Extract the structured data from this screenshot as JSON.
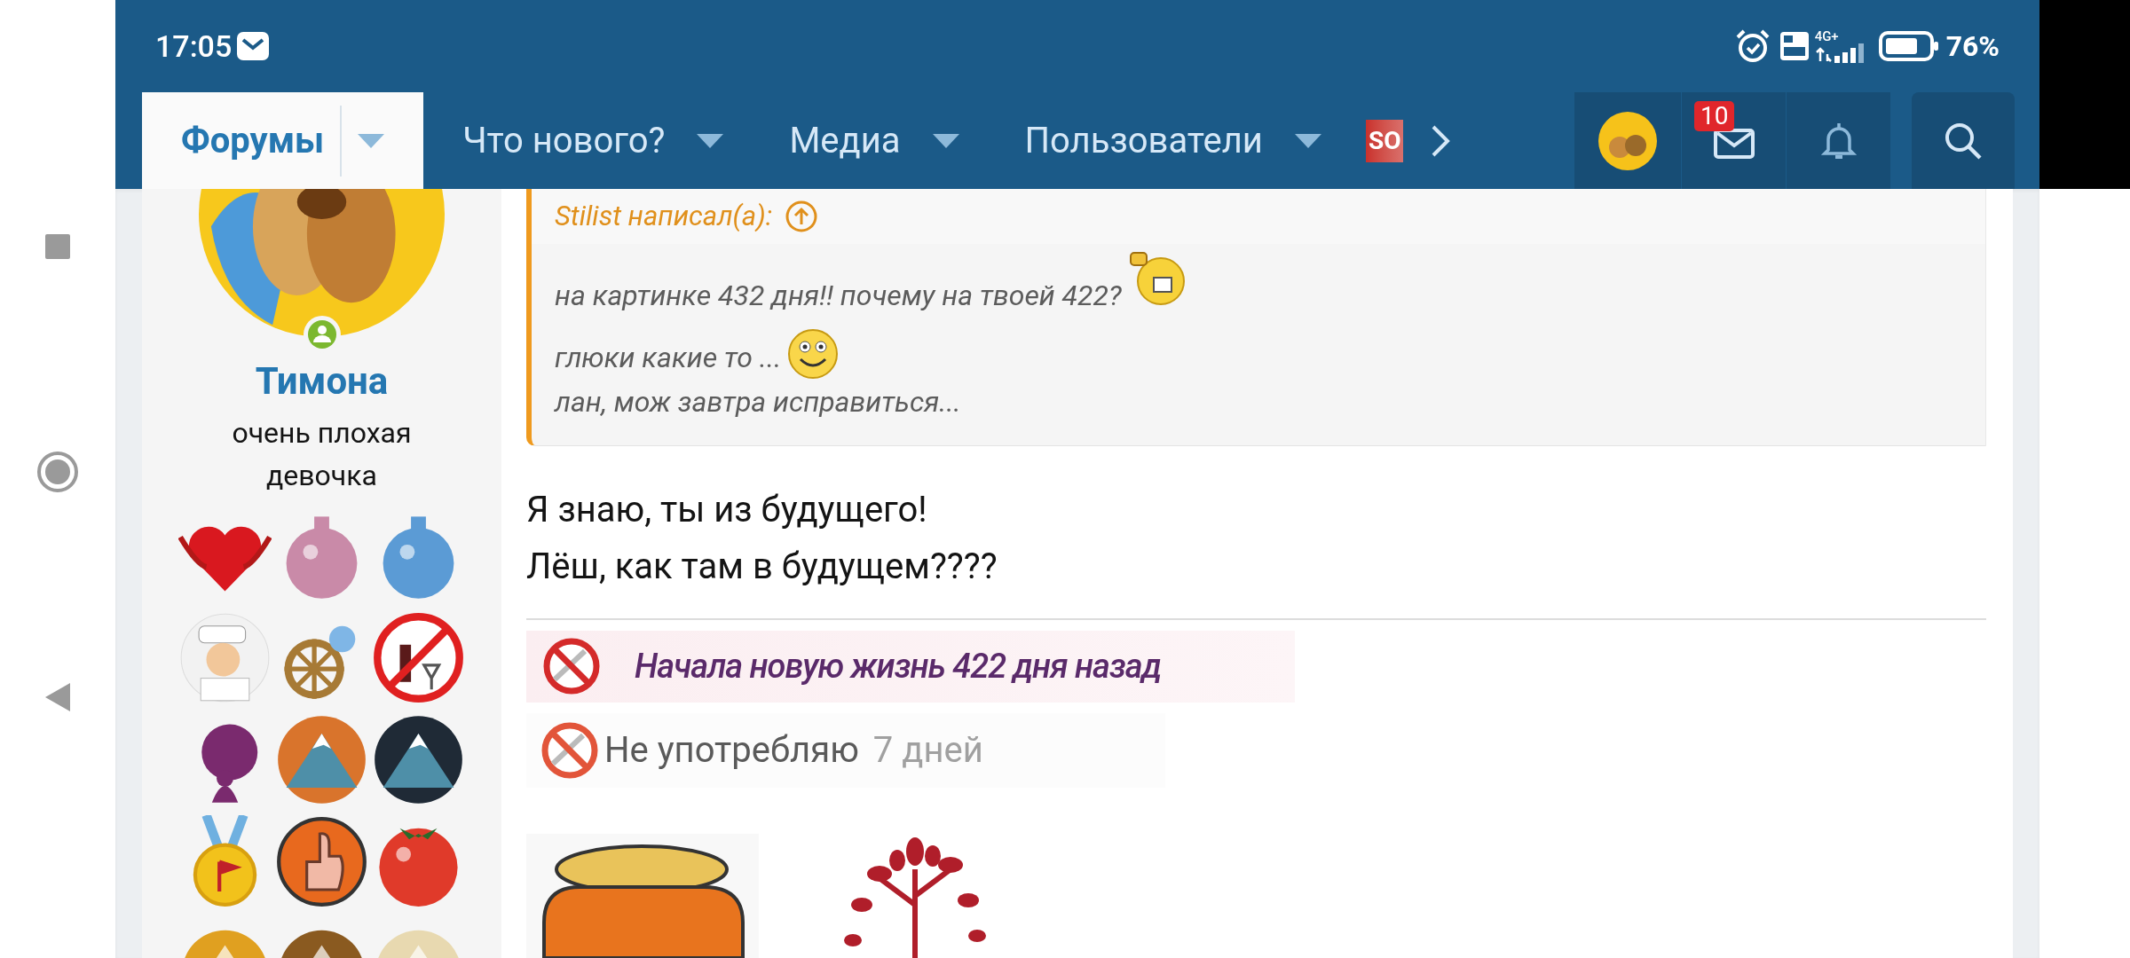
{
  "status_bar": {
    "time": "17:05",
    "network": "4G+",
    "battery": "76%"
  },
  "nav": {
    "tabs": [
      {
        "label": "Форумы",
        "selected": true
      },
      {
        "label": "Что нового?",
        "selected": false
      },
      {
        "label": "Медиа",
        "selected": false
      },
      {
        "label": "Пользователи",
        "selected": false
      }
    ],
    "partial_tab": "SO",
    "inbox_badge": "10"
  },
  "sidebar": {
    "user_name": "Тимона",
    "online": true,
    "user_title": "очень плохая девочка",
    "badges": [
      {
        "kind": "heart",
        "color": "#d9181f"
      },
      {
        "kind": "ornament",
        "color": "#c98aa8"
      },
      {
        "kind": "ornament",
        "color": "#5b9bd5"
      },
      {
        "kind": "captain",
        "color": "#f2f2f2"
      },
      {
        "kind": "helm",
        "color": "#a77a35"
      },
      {
        "kind": "no-alcohol",
        "color": "#e02020"
      },
      {
        "kind": "tree",
        "color": "#7a2a6e"
      },
      {
        "kind": "mountain",
        "color": "#d9742c"
      },
      {
        "kind": "mountain",
        "color": "#1f2a36"
      },
      {
        "kind": "medal",
        "color": "#f2c21b"
      },
      {
        "kind": "thumb",
        "color": "#e8691e"
      },
      {
        "kind": "tomato",
        "color": "#e03a2a"
      },
      {
        "kind": "award",
        "color": "#e0a020"
      },
      {
        "kind": "award",
        "color": "#8a5a20"
      },
      {
        "kind": "award",
        "color": "#e8d9b0"
      }
    ]
  },
  "quote": {
    "header": "Stilist написал(а):",
    "lines": [
      {
        "kind": "grin",
        "text": "на картинке 432 дня!! почему на твоей 422?"
      },
      {
        "kind": "smile",
        "text": "глюки какие то ..."
      },
      {
        "kind": "plain",
        "text": "лан, мож завтра исправиться..."
      }
    ]
  },
  "message": [
    "Я знаю, ты из будущего!",
    "Лёш, как там в будущем????"
  ],
  "signature": {
    "banners": [
      {
        "kind": "pink",
        "text": "Начала новую жизнь 422 дня назад"
      },
      {
        "kind": "plain",
        "text": "Не употребляю",
        "count": "7 дней"
      }
    ],
    "images": [
      {
        "kind": "jar"
      },
      {
        "kind": "tree"
      }
    ]
  }
}
